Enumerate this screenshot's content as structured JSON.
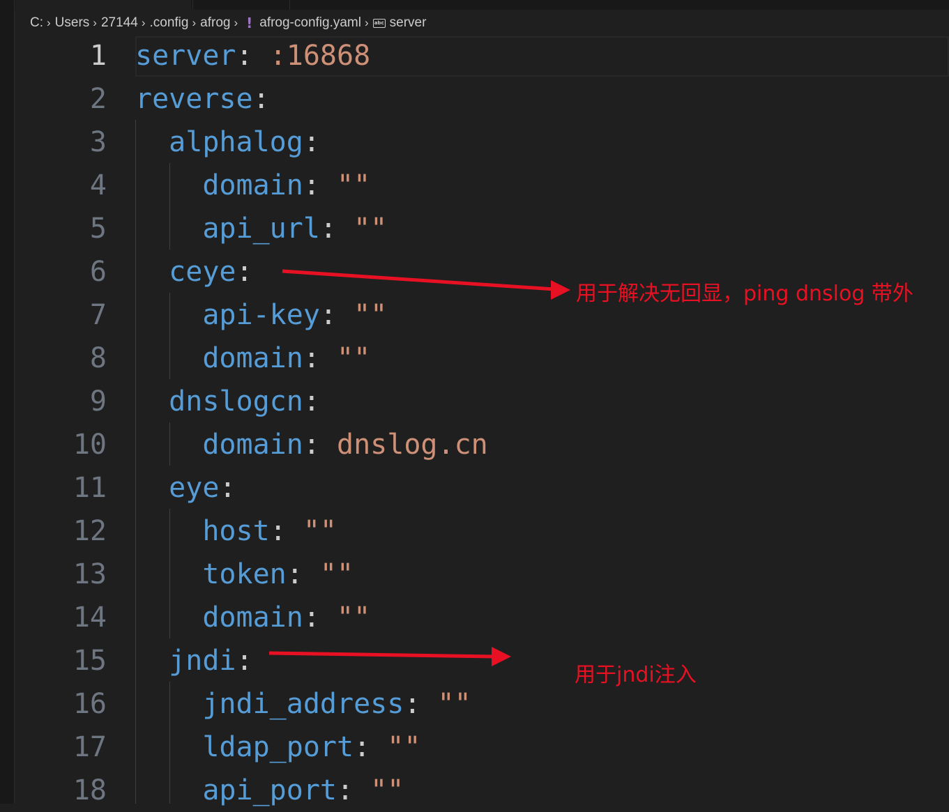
{
  "breadcrumb": {
    "items": [
      "C:",
      "Users",
      "27144",
      ".config",
      "afrog"
    ],
    "file": "afrog-config.yaml",
    "symbol": "server"
  },
  "editor": {
    "lines": [
      {
        "num": "1",
        "tokens": [
          {
            "t": "key",
            "v": "server"
          },
          {
            "t": "punct",
            "v": ": "
          },
          {
            "t": "str",
            "v": ":16868"
          }
        ]
      },
      {
        "num": "2",
        "tokens": [
          {
            "t": "key",
            "v": "reverse"
          },
          {
            "t": "punct",
            "v": ":"
          }
        ]
      },
      {
        "num": "3",
        "tokens": [
          {
            "t": "ws",
            "v": "  "
          },
          {
            "t": "key",
            "v": "alphalog"
          },
          {
            "t": "punct",
            "v": ":"
          }
        ]
      },
      {
        "num": "4",
        "tokens": [
          {
            "t": "ws",
            "v": "    "
          },
          {
            "t": "key",
            "v": "domain"
          },
          {
            "t": "punct",
            "v": ": "
          },
          {
            "t": "str",
            "v": "\"\""
          }
        ]
      },
      {
        "num": "5",
        "tokens": [
          {
            "t": "ws",
            "v": "    "
          },
          {
            "t": "key",
            "v": "api_url"
          },
          {
            "t": "punct",
            "v": ": "
          },
          {
            "t": "str",
            "v": "\"\""
          }
        ]
      },
      {
        "num": "6",
        "tokens": [
          {
            "t": "ws",
            "v": "  "
          },
          {
            "t": "key",
            "v": "ceye"
          },
          {
            "t": "punct",
            "v": ":"
          }
        ]
      },
      {
        "num": "7",
        "tokens": [
          {
            "t": "ws",
            "v": "    "
          },
          {
            "t": "key",
            "v": "api-key"
          },
          {
            "t": "punct",
            "v": ": "
          },
          {
            "t": "str",
            "v": "\"\""
          }
        ]
      },
      {
        "num": "8",
        "tokens": [
          {
            "t": "ws",
            "v": "    "
          },
          {
            "t": "key",
            "v": "domain"
          },
          {
            "t": "punct",
            "v": ": "
          },
          {
            "t": "str",
            "v": "\"\""
          }
        ]
      },
      {
        "num": "9",
        "tokens": [
          {
            "t": "ws",
            "v": "  "
          },
          {
            "t": "key",
            "v": "dnslogcn"
          },
          {
            "t": "punct",
            "v": ":"
          }
        ]
      },
      {
        "num": "10",
        "tokens": [
          {
            "t": "ws",
            "v": "    "
          },
          {
            "t": "key",
            "v": "domain"
          },
          {
            "t": "punct",
            "v": ": "
          },
          {
            "t": "str",
            "v": "dnslog.cn"
          }
        ]
      },
      {
        "num": "11",
        "tokens": [
          {
            "t": "ws",
            "v": "  "
          },
          {
            "t": "key",
            "v": "eye"
          },
          {
            "t": "punct",
            "v": ":"
          }
        ]
      },
      {
        "num": "12",
        "tokens": [
          {
            "t": "ws",
            "v": "    "
          },
          {
            "t": "key",
            "v": "host"
          },
          {
            "t": "punct",
            "v": ": "
          },
          {
            "t": "str",
            "v": "\"\""
          }
        ]
      },
      {
        "num": "13",
        "tokens": [
          {
            "t": "ws",
            "v": "    "
          },
          {
            "t": "key",
            "v": "token"
          },
          {
            "t": "punct",
            "v": ": "
          },
          {
            "t": "str",
            "v": "\"\""
          }
        ]
      },
      {
        "num": "14",
        "tokens": [
          {
            "t": "ws",
            "v": "    "
          },
          {
            "t": "key",
            "v": "domain"
          },
          {
            "t": "punct",
            "v": ": "
          },
          {
            "t": "str",
            "v": "\"\""
          }
        ]
      },
      {
        "num": "15",
        "tokens": [
          {
            "t": "ws",
            "v": "  "
          },
          {
            "t": "key",
            "v": "jndi"
          },
          {
            "t": "punct",
            "v": ":"
          }
        ]
      },
      {
        "num": "16",
        "tokens": [
          {
            "t": "ws",
            "v": "    "
          },
          {
            "t": "key",
            "v": "jndi_address"
          },
          {
            "t": "punct",
            "v": ": "
          },
          {
            "t": "str",
            "v": "\"\""
          }
        ]
      },
      {
        "num": "17",
        "tokens": [
          {
            "t": "ws",
            "v": "    "
          },
          {
            "t": "key",
            "v": "ldap_port"
          },
          {
            "t": "punct",
            "v": ": "
          },
          {
            "t": "str",
            "v": "\"\""
          }
        ]
      },
      {
        "num": "18",
        "tokens": [
          {
            "t": "ws",
            "v": "    "
          },
          {
            "t": "key",
            "v": "api_port"
          },
          {
            "t": "punct",
            "v": ": "
          },
          {
            "t": "str",
            "v": "\"\""
          }
        ]
      }
    ],
    "active_line": "1"
  },
  "annotations": {
    "ceye_note": "用于解决无回显，ping dnslog 带外",
    "jndi_note": "用于jndi注入",
    "color": "#e81123"
  },
  "colors": {
    "key": "#569cd6",
    "string": "#ce9178",
    "punct": "#cccccc",
    "background": "#1f1f1f"
  }
}
